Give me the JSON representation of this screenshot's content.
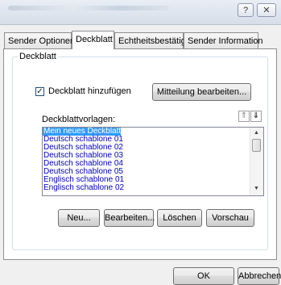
{
  "titlebar": {
    "help_label": "?",
    "close_icon": "close-icon"
  },
  "tabs": [
    {
      "label": "Sender Optionen",
      "active": false
    },
    {
      "label": "Deckblatt",
      "active": true
    },
    {
      "label": "Echtheitsbestätigung",
      "active": false
    },
    {
      "label": "Sender Information",
      "active": false
    }
  ],
  "group": {
    "legend": "Deckblatt"
  },
  "checkbox": {
    "label": "Deckblatt hinzufügen",
    "checked": true,
    "mark": "✓"
  },
  "edit_message_button": "Mitteilung bearbeiten...",
  "templates": {
    "label": "Deckblattvorlagen:",
    "items": [
      "Mein neues Deckblatt",
      "Deutsch schablone 01",
      "Deutsch schablone 02",
      "Deutsch schablone 03",
      "Deutsch schablone 04",
      "Deutsch schablone 05",
      "Englisch schablone 01",
      "Englisch schablone 02"
    ],
    "selected_index": 0,
    "sort_up": "⇑",
    "sort_down": "⇓"
  },
  "actions": {
    "new": "Neu...",
    "edit": "Bearbeiten...",
    "delete": "Löschen",
    "preview": "Vorschau"
  },
  "footer": {
    "ok": "OK",
    "cancel": "Abbrechen"
  }
}
